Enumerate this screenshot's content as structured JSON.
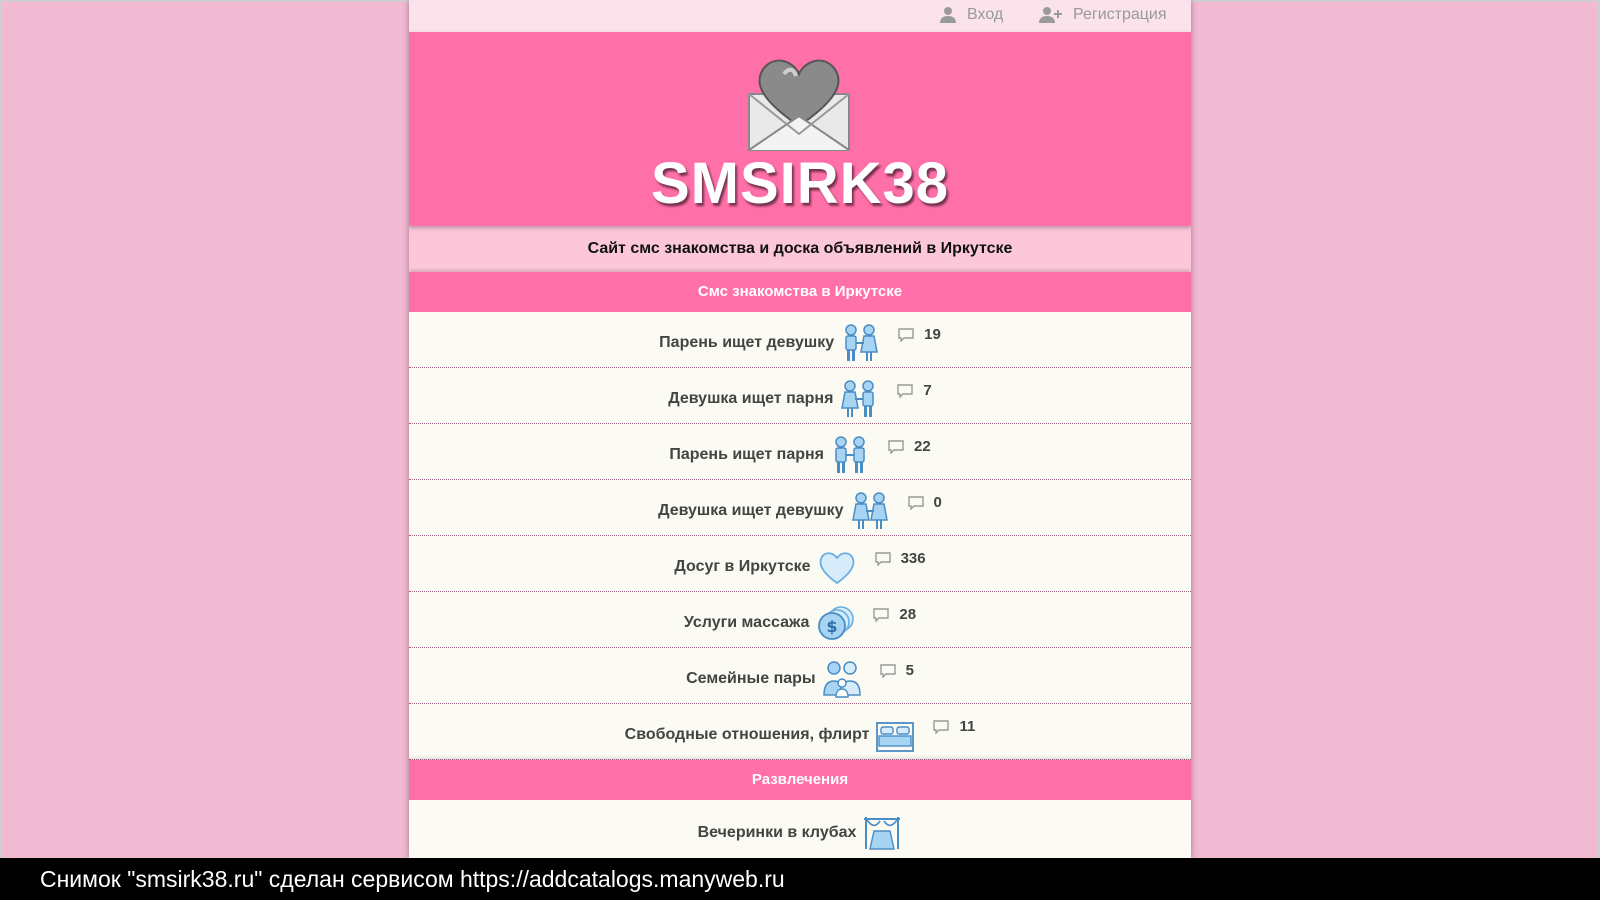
{
  "topbar": {
    "login_label": "Вход",
    "register_label": "Регистрация"
  },
  "header": {
    "brand": "SMSIRK38",
    "logo_icon": "heart-envelope-icon"
  },
  "subtitle": "Сайт смс знакомства и доска объявлений в Иркутске",
  "sections": [
    {
      "title": "Смс знакомства в Иркутске",
      "items": [
        {
          "label": "Парень ищет девушку",
          "icon": "couple-icon",
          "count": "19"
        },
        {
          "label": "Девушка ищет парня",
          "icon": "couple-icon",
          "count": "7"
        },
        {
          "label": "Парень ищет парня",
          "icon": "two-men-icon",
          "count": "22"
        },
        {
          "label": "Девушка ищет девушку",
          "icon": "two-women-icon",
          "count": "0"
        },
        {
          "label": "Досуг в Иркутске",
          "icon": "heart-icon",
          "count": "336"
        },
        {
          "label": "Услуги массажа",
          "icon": "coins-icon",
          "count": "28"
        },
        {
          "label": "Семейные пары",
          "icon": "family-icon",
          "count": "5"
        },
        {
          "label": "Свободные отношения, флирт",
          "icon": "bed-icon",
          "count": "11"
        }
      ]
    },
    {
      "title": "Развлечения",
      "items": [
        {
          "label": "Вечеринки в клубах",
          "icon": "stage-icon"
        }
      ]
    }
  ],
  "footer_caption": "Снимок \"smsirk38.ru\" сделан сервисом https://addcatalogs.manyweb.ru",
  "colors": {
    "background": "#f2b9d2",
    "header": "#ff6fa8",
    "row": "#fbfaf3",
    "icon_blue": "#6aaee0"
  }
}
